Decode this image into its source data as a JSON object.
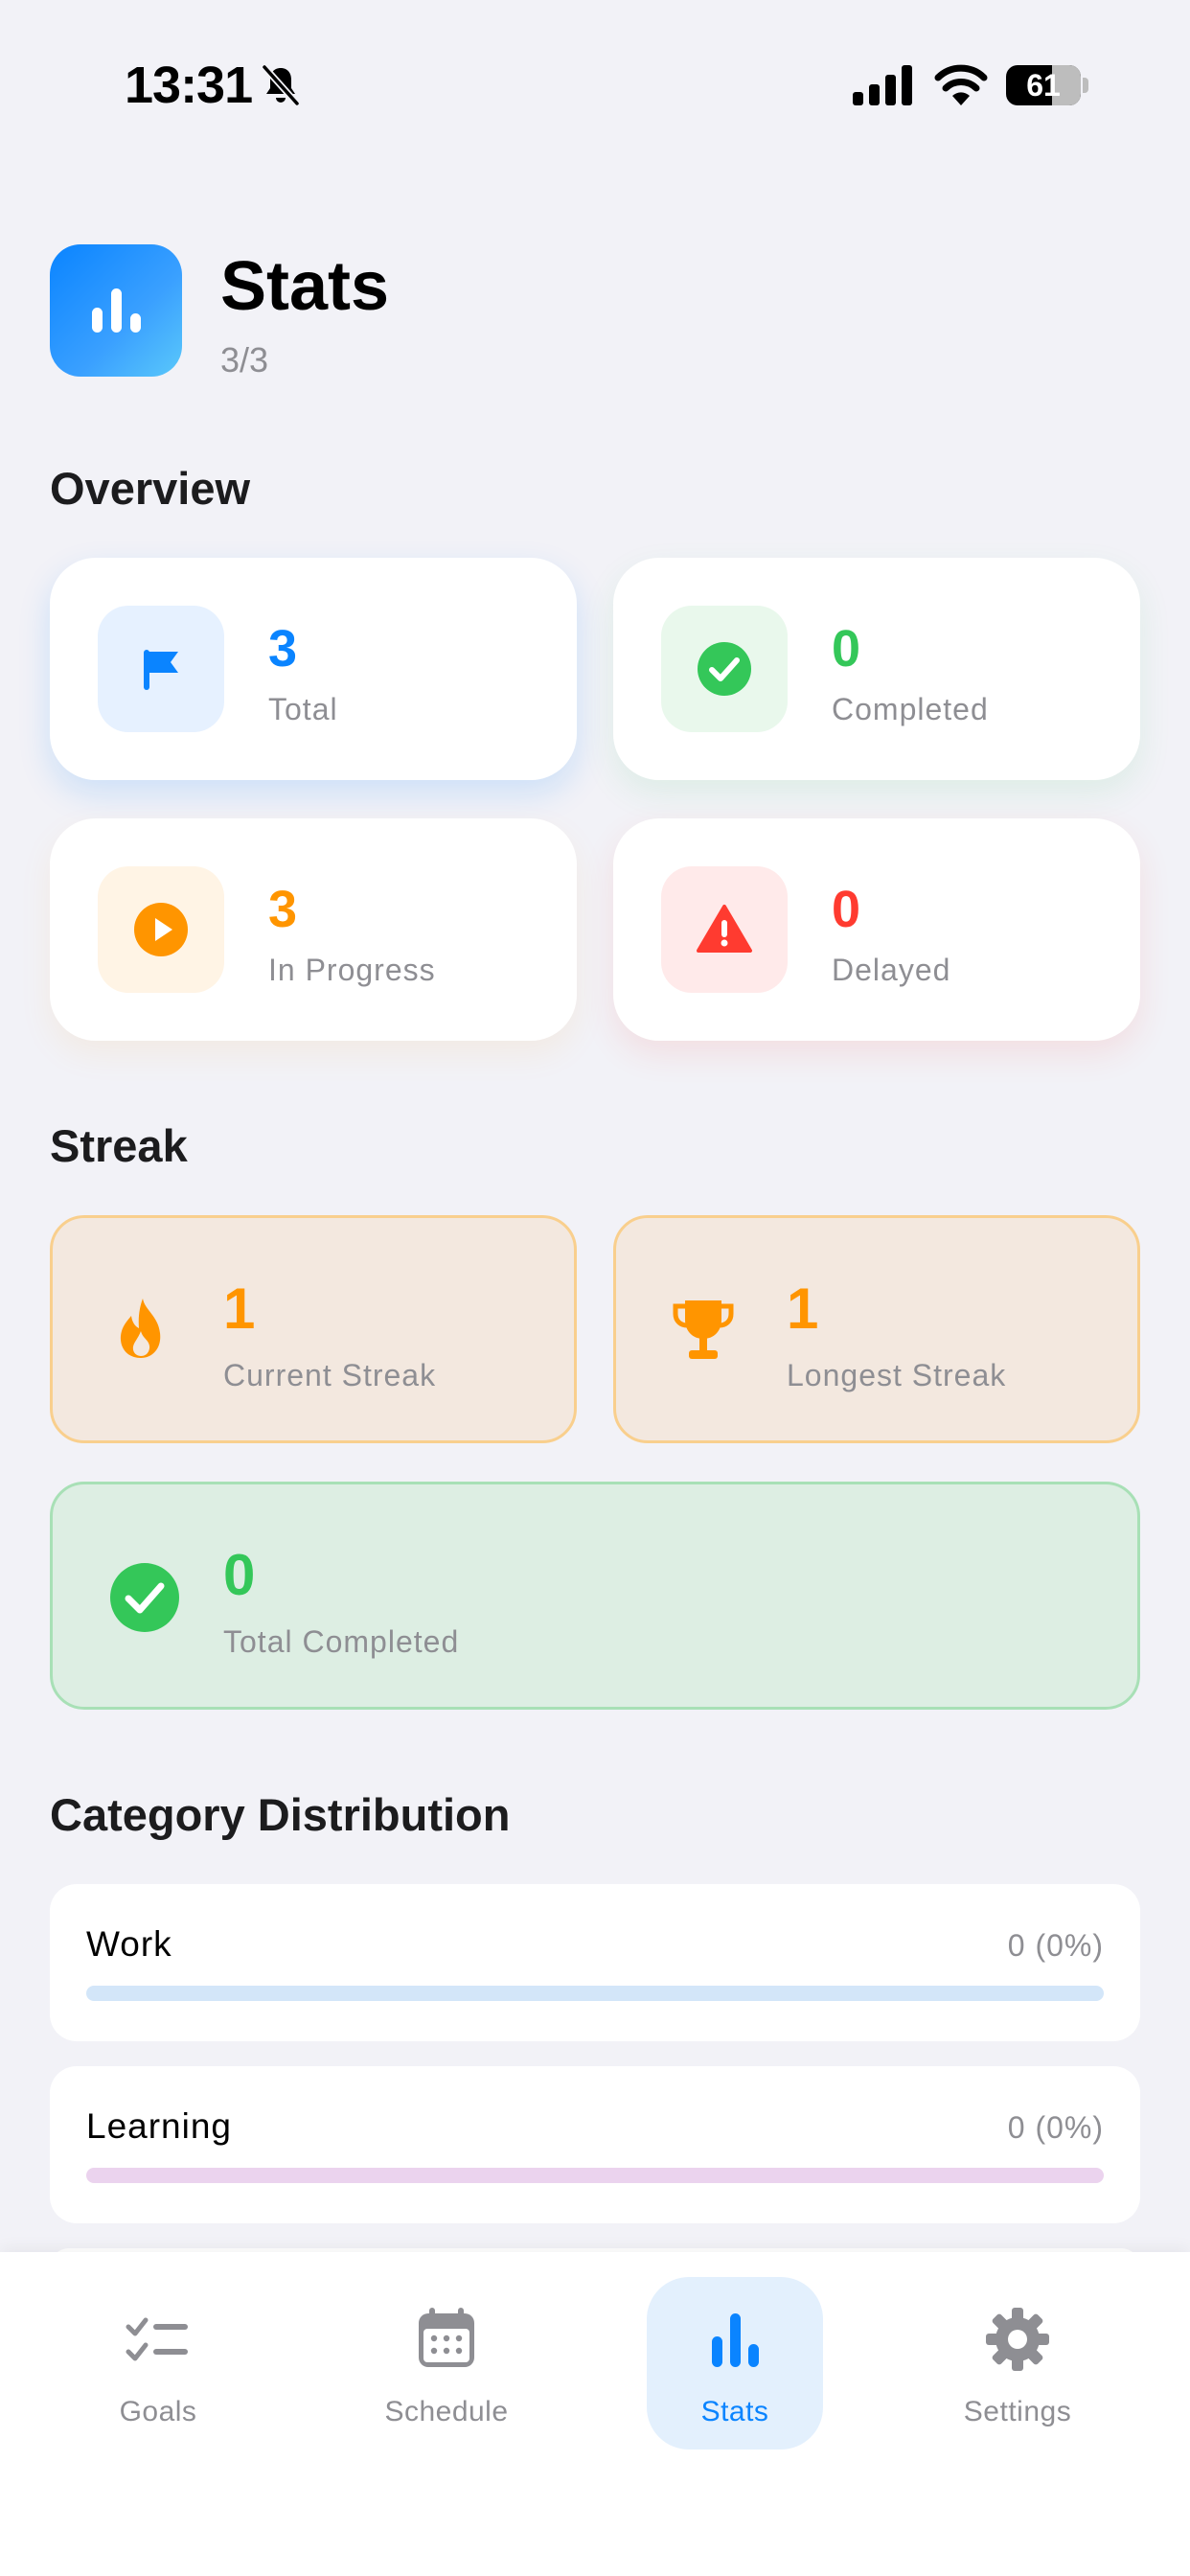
{
  "status_bar": {
    "time": "13:31",
    "battery_level": "61",
    "icons": [
      "bell-slash-icon",
      "cellular-signal-icon",
      "wifi-icon",
      "battery-icon"
    ]
  },
  "header": {
    "icon": "bar-chart-icon",
    "title": "Stats",
    "subtitle": "3/3"
  },
  "overview": {
    "title": "Overview",
    "cards": [
      {
        "value": "3",
        "label": "Total",
        "icon": "flag-icon",
        "color": "#0A84FF",
        "icon_bg": "#E6F1FF"
      },
      {
        "value": "0",
        "label": "Completed",
        "icon": "checkmark-circle-icon",
        "color": "#34C759",
        "icon_bg": "#E9F8EC"
      },
      {
        "value": "3",
        "label": "In Progress",
        "icon": "play-circle-icon",
        "color": "#FF9500",
        "icon_bg": "#FFF4E5"
      },
      {
        "value": "0",
        "label": "Delayed",
        "icon": "warning-triangle-icon",
        "color": "#FF3B30",
        "icon_bg": "#FFEAEA"
      }
    ]
  },
  "streak": {
    "title": "Streak",
    "current": {
      "value": "1",
      "label": "Current Streak",
      "icon": "flame-icon",
      "color": "#FF9500"
    },
    "longest": {
      "value": "1",
      "label": "Longest Streak",
      "icon": "trophy-icon",
      "color": "#FF9500"
    },
    "total_completed": {
      "value": "0",
      "label": "Total Completed",
      "icon": "checkmark-circle-icon",
      "color": "#34C759"
    }
  },
  "category_distribution": {
    "title": "Category Distribution",
    "items": [
      {
        "name": "Work",
        "count": "0 (0%)",
        "fraction": 0,
        "track_color": "#D3E6F9"
      },
      {
        "name": "Learning",
        "count": "0 (0%)",
        "fraction": 0,
        "track_color": "#EBD3EE"
      }
    ]
  },
  "tab_bar": {
    "active": "Stats",
    "tabs": [
      {
        "label": "Goals",
        "icon": "checklist-icon"
      },
      {
        "label": "Schedule",
        "icon": "calendar-icon"
      },
      {
        "label": "Stats",
        "icon": "bar-chart-icon"
      },
      {
        "label": "Settings",
        "icon": "gear-icon"
      }
    ]
  }
}
